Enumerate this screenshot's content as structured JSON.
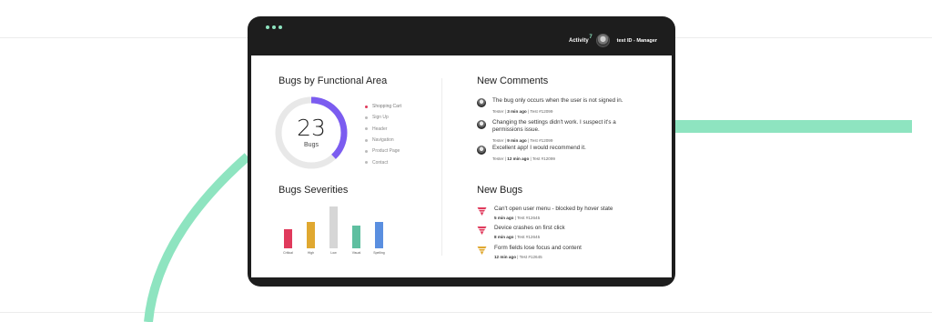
{
  "topbar": {
    "activity_label": "Activity",
    "activity_mark": "7",
    "user_label": "test ID - Manager"
  },
  "functional_area": {
    "title": "Bugs by Functional Area",
    "count": "23",
    "count_label": "Bugs",
    "progress_fraction": 0.38,
    "legend": [
      {
        "label": "Shopping Cart",
        "active": true
      },
      {
        "label": "Sign Up",
        "active": false
      },
      {
        "label": "Header",
        "active": false
      },
      {
        "label": "Navigation",
        "active": false
      },
      {
        "label": "Product Page",
        "active": false
      },
      {
        "label": "Contact",
        "active": false
      }
    ]
  },
  "severities": {
    "title": "Bugs Severities"
  },
  "chart_data": {
    "type": "bar",
    "categories": [
      "Critical",
      "High",
      "Low",
      "Visual",
      "Spelling"
    ],
    "values": [
      5,
      7,
      11,
      6,
      7
    ],
    "colors": [
      "#e03a5c",
      "#e0a830",
      "#d6d6d6",
      "#5fbfa0",
      "#5a8fe0"
    ],
    "ylim": [
      0,
      12
    ],
    "title": "Bugs Severities"
  },
  "comments": {
    "title": "New Comments",
    "items": [
      {
        "text": "The bug only occurs when the user is not signed in.",
        "author": "Tester",
        "time": "3 min ago",
        "ref": "Test #12099"
      },
      {
        "text": "Changing the settings didn't work. I suspect it's a permissions issue.",
        "author": "Tester",
        "time": "9 min ago",
        "ref": "Test #12099"
      },
      {
        "text": "Excellent app! I would recommend it.",
        "author": "Tester",
        "time": "12 min ago",
        "ref": "Test #12099"
      }
    ]
  },
  "bugs": {
    "title": "New Bugs",
    "items": [
      {
        "text": "Can't open user menu - blocked by hover state",
        "time": "5 min ago",
        "ref": "Test #12645",
        "color": "#e03a5c"
      },
      {
        "text": "Device crashes on first click",
        "time": "8 min ago",
        "ref": "Test #12645",
        "color": "#e03a5c"
      },
      {
        "text": "Form fields lose focus and content",
        "time": "12 min ago",
        "ref": "Test #12645",
        "color": "#e0a830"
      }
    ]
  },
  "colors": {
    "accent_mint": "#8ee4c0",
    "accent_purple": "#7b5cf0",
    "device_frame": "#1d1d1d"
  },
  "icons": [
    "menu-dots-icon",
    "user-avatar-icon",
    "bug-severity-icon"
  ]
}
